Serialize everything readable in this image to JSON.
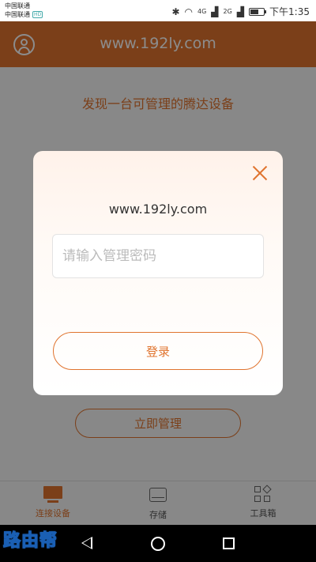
{
  "status_bar": {
    "carrier_1": "中国联通",
    "carrier_2": "中国联通",
    "network_1": "4G",
    "network_2": "2G",
    "time": "下午1:35",
    "battery_level": 0.6
  },
  "header": {
    "title": "www.192ly.com",
    "avatar_icon": "user-icon",
    "background_color": "#e0742f"
  },
  "main": {
    "found_text": "发现一台可管理的腾达设备",
    "manage_button": "立即管理"
  },
  "dialog": {
    "title": "www.192ly.com",
    "password_placeholder": "请输入管理密码",
    "password_value": "",
    "login_button": "登录",
    "close_icon": "close-icon"
  },
  "tabs": [
    {
      "label": "连接设备",
      "icon": "monitor-icon",
      "active": true
    },
    {
      "label": "存储",
      "icon": "drive-icon",
      "active": false
    },
    {
      "label": "工具箱",
      "icon": "toolbox-icon",
      "active": false
    }
  ],
  "watermark": "路由帮",
  "accent_color": "#e0742f"
}
